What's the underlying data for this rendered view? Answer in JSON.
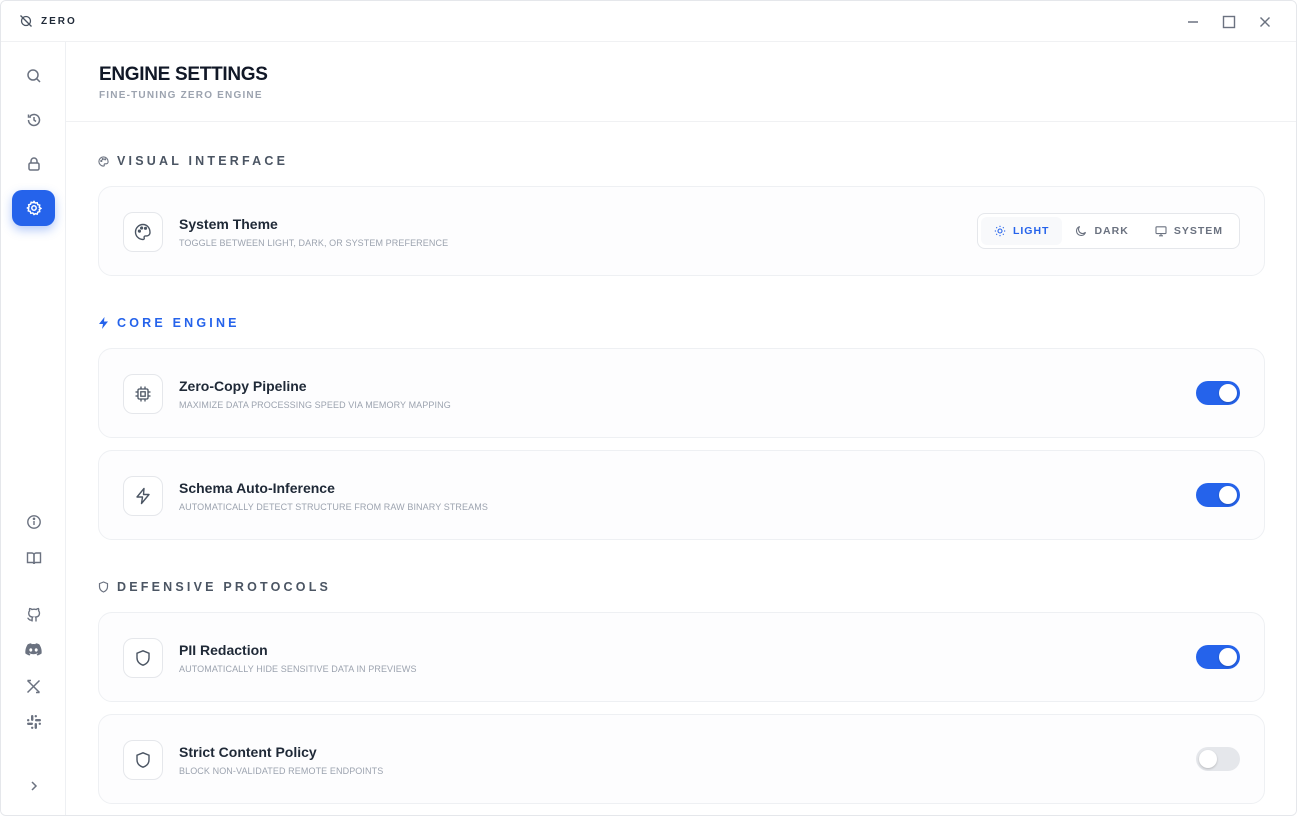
{
  "app": {
    "name": "ZERO"
  },
  "window_controls": {
    "minimize": "minimize-icon",
    "maximize": "maximize-icon",
    "close": "close-icon"
  },
  "sidebar": {
    "top": [
      {
        "icon": "search-icon"
      },
      {
        "icon": "history-icon"
      },
      {
        "icon": "lock-icon"
      },
      {
        "icon": "gear-icon",
        "active": true
      }
    ],
    "bottom": [
      {
        "icon": "info-icon"
      },
      {
        "icon": "book-icon"
      },
      {
        "icon": "github-icon"
      },
      {
        "icon": "discord-icon"
      },
      {
        "icon": "x-icon"
      },
      {
        "icon": "slack-icon"
      },
      {
        "icon": "chevron-right-icon"
      }
    ]
  },
  "header": {
    "title": "ENGINE SETTINGS",
    "subtitle": "FINE-TUNING ZERO ENGINE"
  },
  "sections": {
    "visual": {
      "title": "VISUAL INTERFACE",
      "theme": {
        "title": "System Theme",
        "desc": "TOGGLE BETWEEN LIGHT, DARK, OR SYSTEM PREFERENCE",
        "options": [
          "LIGHT",
          "DARK",
          "SYSTEM"
        ],
        "selected": "LIGHT"
      }
    },
    "core": {
      "title": "CORE ENGINE",
      "items": [
        {
          "title": "Zero-Copy Pipeline",
          "desc": "MAXIMIZE DATA PROCESSING SPEED VIA MEMORY MAPPING",
          "enabled": true
        },
        {
          "title": "Schema Auto-Inference",
          "desc": "AUTOMATICALLY DETECT STRUCTURE FROM RAW BINARY STREAMS",
          "enabled": true
        }
      ]
    },
    "defensive": {
      "title": "DEFENSIVE PROTOCOLS",
      "items": [
        {
          "title": "PII Redaction",
          "desc": "AUTOMATICALLY HIDE SENSITIVE DATA IN PREVIEWS",
          "enabled": true
        },
        {
          "title": "Strict Content Policy",
          "desc": "BLOCK NON-VALIDATED REMOTE ENDPOINTS",
          "enabled": false
        }
      ]
    }
  },
  "colors": {
    "accent": "#2563eb",
    "text": "#111827",
    "muted": "#9ca3af",
    "border": "#eef0f3"
  }
}
